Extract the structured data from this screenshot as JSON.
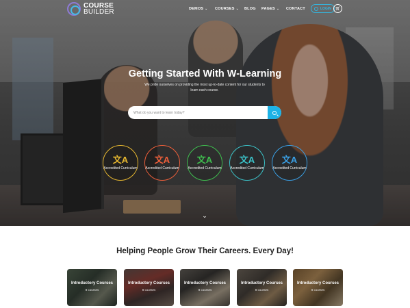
{
  "brand": {
    "line1": "COURSE",
    "line2": "BUILDER"
  },
  "nav": {
    "items": [
      {
        "label": "DEMOS",
        "dropdown": true
      },
      {
        "label": "COURSES",
        "dropdown": true
      },
      {
        "label": "BLOG",
        "dropdown": false
      },
      {
        "label": "PAGES",
        "dropdown": true
      },
      {
        "label": "CONTACT",
        "dropdown": false
      }
    ],
    "login_label": "LOGIN",
    "cart_icon": "cart-icon"
  },
  "hero": {
    "title": "Getting Started With W-Learning",
    "subtitle": "We pride ourselves on providing the most up-to-date content for our students to learn each course.",
    "search_placeholder": "What do you want to learn today?",
    "badges": [
      {
        "label": "Accredited Curriculum",
        "color": "#e7b830",
        "icon": "translate-icon"
      },
      {
        "label": "Accredited Curriculum",
        "color": "#ee5f3a",
        "icon": "translate-icon"
      },
      {
        "label": "Accredited Curriculum",
        "color": "#3fbf4f",
        "icon": "translate-icon"
      },
      {
        "label": "Accredited Curriculum",
        "color": "#3bc3c9",
        "icon": "translate-icon"
      },
      {
        "label": "Accredited Curriculum",
        "color": "#3aa0e6",
        "icon": "translate-icon"
      }
    ]
  },
  "section": {
    "title": "Helping People Grow Their Careers. Every Day!",
    "cards": [
      {
        "title": "Introductory Courses",
        "count": "8 courses"
      },
      {
        "title": "Introductory Courses",
        "count": "8 courses"
      },
      {
        "title": "Introductory Courses",
        "count": "8 courses"
      },
      {
        "title": "Introductory Courses",
        "count": "8 courses"
      },
      {
        "title": "Introductory Courses",
        "count": "8 courses"
      }
    ]
  },
  "colors": {
    "accent": "#1db2e6",
    "login": "#33b6df"
  }
}
